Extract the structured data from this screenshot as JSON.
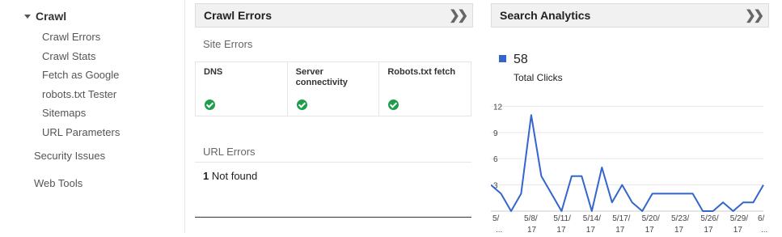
{
  "sidebar": {
    "section_label": "Crawl",
    "sub_items": [
      "Crawl Errors",
      "Crawl Stats",
      "Fetch as Google",
      "robots.txt Tester",
      "Sitemaps",
      "URL Parameters"
    ],
    "top_items": [
      "Security Issues",
      "Web Tools"
    ]
  },
  "crawl_errors": {
    "title": "Crawl Errors",
    "site_errors_label": "Site Errors",
    "columns": [
      {
        "label": "DNS",
        "status": "ok"
      },
      {
        "label": "Server connectivity",
        "status": "ok"
      },
      {
        "label": "Robots.txt fetch",
        "status": "ok"
      }
    ],
    "url_errors_label": "URL Errors",
    "url_error_count": "1",
    "url_error_text": "Not found"
  },
  "search_analytics": {
    "title": "Search Analytics",
    "total_clicks_value": "58",
    "total_clicks_label": "Total Clicks",
    "series_color": "#3366cc"
  },
  "chart_data": {
    "type": "line",
    "y_ticks": [
      3,
      6,
      9,
      12
    ],
    "ylim": [
      0,
      12.5
    ],
    "x_tick_labels": [
      "5/",
      "5/8/",
      "5/11/",
      "5/14/",
      "5/17/",
      "5/20/",
      "5/23/",
      "5/26/",
      "5/29/",
      "6/"
    ],
    "x_tick_labels_line2": [
      "...",
      "17",
      "17",
      "17",
      "17",
      "17",
      "17",
      "17",
      "17",
      "..."
    ],
    "series": [
      {
        "values": [
          3,
          2,
          0,
          2,
          11,
          4,
          2,
          0,
          4,
          4,
          0,
          5,
          1,
          3,
          1,
          0,
          2,
          2,
          2,
          2,
          2,
          0,
          0,
          1,
          0,
          1,
          1,
          3
        ]
      }
    ]
  }
}
